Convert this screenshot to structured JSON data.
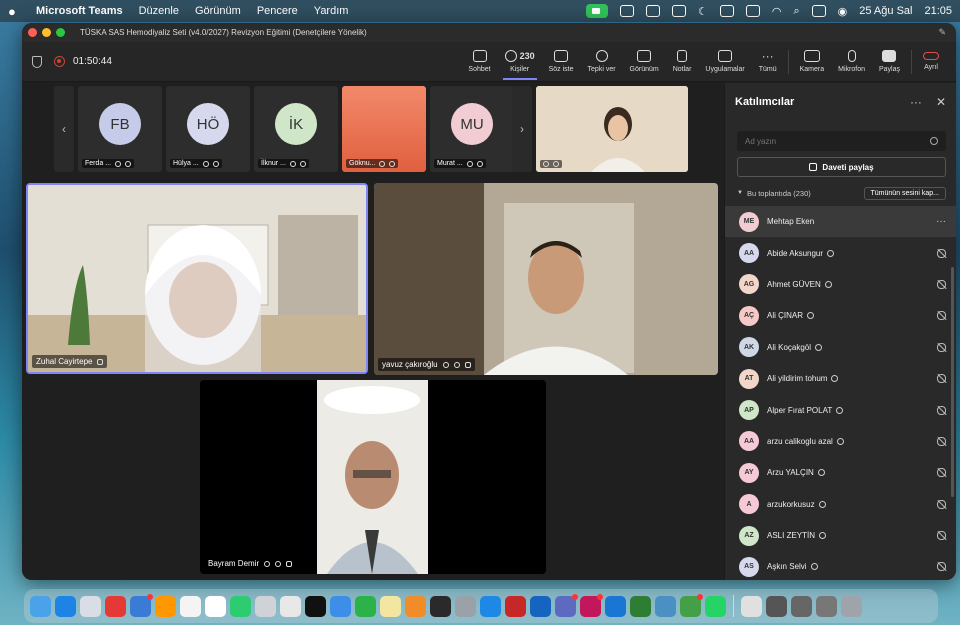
{
  "menubar": {
    "app_name": "Microsoft Teams",
    "menus": [
      "Düzenle",
      "Görünüm",
      "Pencere",
      "Yardım"
    ],
    "date": "25 Ağu Sal",
    "time": "21:05"
  },
  "window": {
    "title": "TÜSKA SAS Hemodiyaliz Seti (v4.0/2027) Revizyon Eğitimi (Denetçilere Yönelik)"
  },
  "toolbar": {
    "timer": "01:50:44",
    "chat_label": "Sohbet",
    "people_label": "Kişiler",
    "people_count": "230",
    "raise_label": "Söz iste",
    "react_label": "Tepki ver",
    "view_label": "Görünüm",
    "notes_label": "Notlar",
    "apps_label": "Uygulamalar",
    "more_label": "Tümü",
    "camera_label": "Kamera",
    "mic_label": "Mikrofon",
    "share_label": "Paylaş",
    "leave_label": "Ayrıl"
  },
  "strip": [
    {
      "initials": "FB",
      "name": "Ferda ...",
      "color": "#c5cbe8"
    },
    {
      "initials": "HÖ",
      "name": "Hülya ...",
      "color": "#d6d8ee"
    },
    {
      "initials": "İK",
      "name": "İlknur ...",
      "color": "#cfe6c9"
    },
    {
      "initials": "",
      "name": "Göknu...",
      "color": "#e98b6d"
    },
    {
      "initials": "MU",
      "name": "Murat ...",
      "color": "#f1cdd3"
    }
  ],
  "videos": {
    "v1_name": "Zuhal Cayirtepe",
    "v2_name": "yavuz çakıroğlu",
    "v3_name": "Bayram Demir"
  },
  "panel": {
    "title": "Katılımcılar",
    "search_placeholder": "Ad yazın",
    "invite_label": "Daveti paylaş",
    "section_label": "Bu toplantıda (230)",
    "mute_all_label": "Tümünün sesini kap...",
    "participants": [
      {
        "initials": "ME",
        "name": "Mehtap Eken",
        "color": "#f1cdd3"
      },
      {
        "initials": "AA",
        "name": "Abide Aksungur",
        "color": "#d6d8ee"
      },
      {
        "initials": "AG",
        "name": "Ahmet GÜVEN",
        "color": "#f2d6c9"
      },
      {
        "initials": "AÇ",
        "name": "Ali ÇINAR",
        "color": "#f6c9c6"
      },
      {
        "initials": "AK",
        "name": "Ali Koçakgöl",
        "color": "#cfd6e6"
      },
      {
        "initials": "AT",
        "name": "Ali yildirim tohum",
        "color": "#f2d6c9"
      },
      {
        "initials": "AP",
        "name": "Alper Fırat POLAT",
        "color": "#cfe6c9"
      },
      {
        "initials": "AA",
        "name": "arzu calikoglu azal",
        "color": "#f6c9d6"
      },
      {
        "initials": "AY",
        "name": "Arzu YALÇIN",
        "color": "#f6c9d6"
      },
      {
        "initials": "A",
        "name": "arzukorkusuz",
        "color": "#f6c9d6"
      },
      {
        "initials": "AZ",
        "name": "ASLI ZEYTİN",
        "color": "#cfe6c9"
      },
      {
        "initials": "AS",
        "name": "Aşkın Selvi",
        "color": "#d6d8ee"
      }
    ]
  }
}
